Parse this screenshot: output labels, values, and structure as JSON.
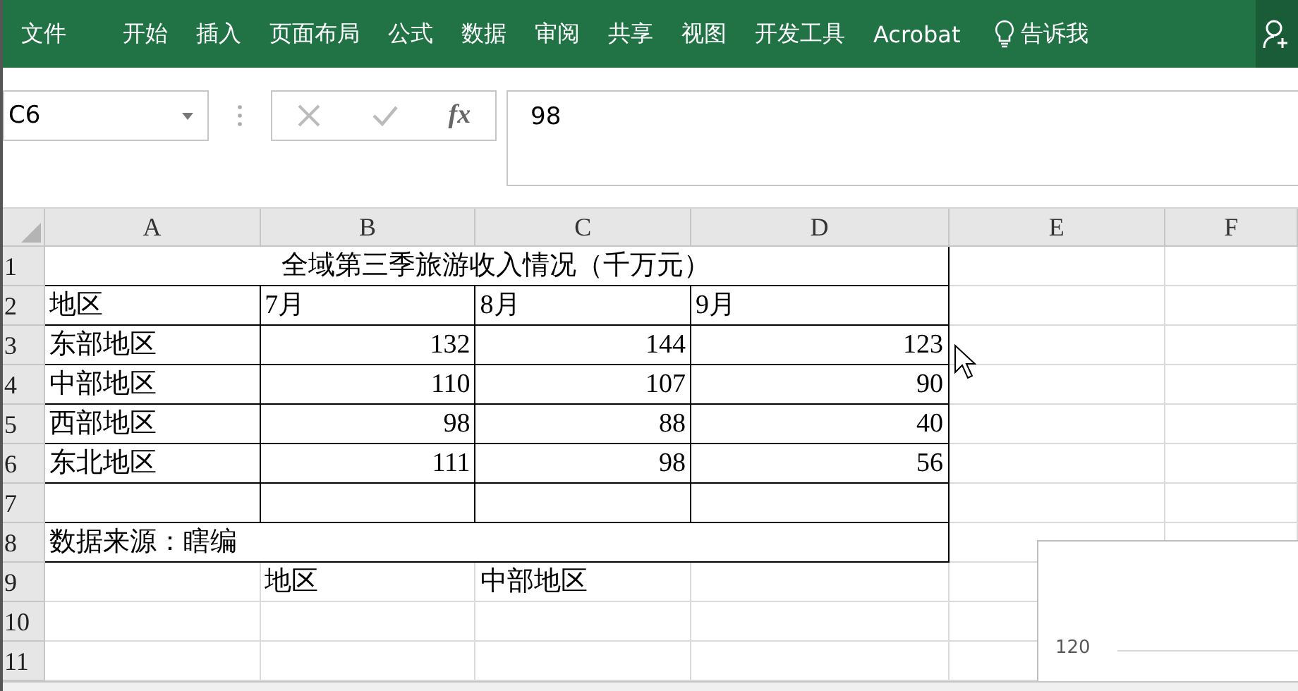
{
  "ribbon": {
    "tabs": [
      {
        "label": "文件"
      },
      {
        "label": "开始"
      },
      {
        "label": "插入"
      },
      {
        "label": "页面布局"
      },
      {
        "label": "公式"
      },
      {
        "label": "数据"
      },
      {
        "label": "审阅"
      },
      {
        "label": "共享"
      },
      {
        "label": "视图"
      },
      {
        "label": "开发工具"
      },
      {
        "label": "Acrobat"
      }
    ],
    "tell_me": "告诉我"
  },
  "formula_bar": {
    "name_box": "C6",
    "function_label": "fx",
    "value": "98"
  },
  "sheet": {
    "columns": [
      "A",
      "B",
      "C",
      "D",
      "E",
      "F"
    ],
    "rows": [
      {
        "number": "1",
        "kind": "title",
        "text": "全域第三季旅游收入情况（千万元）"
      },
      {
        "number": "2",
        "kind": "table",
        "cells": [
          {
            "text": "地区",
            "kind": "text"
          },
          {
            "text": "7月",
            "kind": "text"
          },
          {
            "text": "8月",
            "kind": "text"
          },
          {
            "text": "9月",
            "kind": "text"
          }
        ]
      },
      {
        "number": "3",
        "kind": "table",
        "cells": [
          {
            "text": "东部地区",
            "kind": "text"
          },
          {
            "text": "132",
            "kind": "number"
          },
          {
            "text": "144",
            "kind": "number"
          },
          {
            "text": "123",
            "kind": "number"
          }
        ]
      },
      {
        "number": "4",
        "kind": "table",
        "cells": [
          {
            "text": "中部地区",
            "kind": "text"
          },
          {
            "text": "110",
            "kind": "number"
          },
          {
            "text": "107",
            "kind": "number"
          },
          {
            "text": "90",
            "kind": "number"
          }
        ]
      },
      {
        "number": "5",
        "kind": "table",
        "cells": [
          {
            "text": "西部地区",
            "kind": "text"
          },
          {
            "text": "98",
            "kind": "number"
          },
          {
            "text": "88",
            "kind": "number"
          },
          {
            "text": "40",
            "kind": "number"
          }
        ]
      },
      {
        "number": "6",
        "kind": "table",
        "cells": [
          {
            "text": "东北地区",
            "kind": "text"
          },
          {
            "text": "111",
            "kind": "number"
          },
          {
            "text": "98",
            "kind": "number"
          },
          {
            "text": "56",
            "kind": "number"
          }
        ]
      },
      {
        "number": "7",
        "kind": "table",
        "cells": []
      },
      {
        "number": "8",
        "kind": "note",
        "text": "数据来源：瞎编"
      },
      {
        "number": "9",
        "kind": "plain",
        "cells": [
          null,
          {
            "text": "地区",
            "kind": "text"
          },
          {
            "text": "中部地区",
            "kind": "text"
          }
        ]
      },
      {
        "number": "10",
        "kind": "plain",
        "cells": []
      },
      {
        "number": "11",
        "kind": "plain",
        "cells": []
      }
    ]
  },
  "chart": {
    "axis_label": "120"
  }
}
